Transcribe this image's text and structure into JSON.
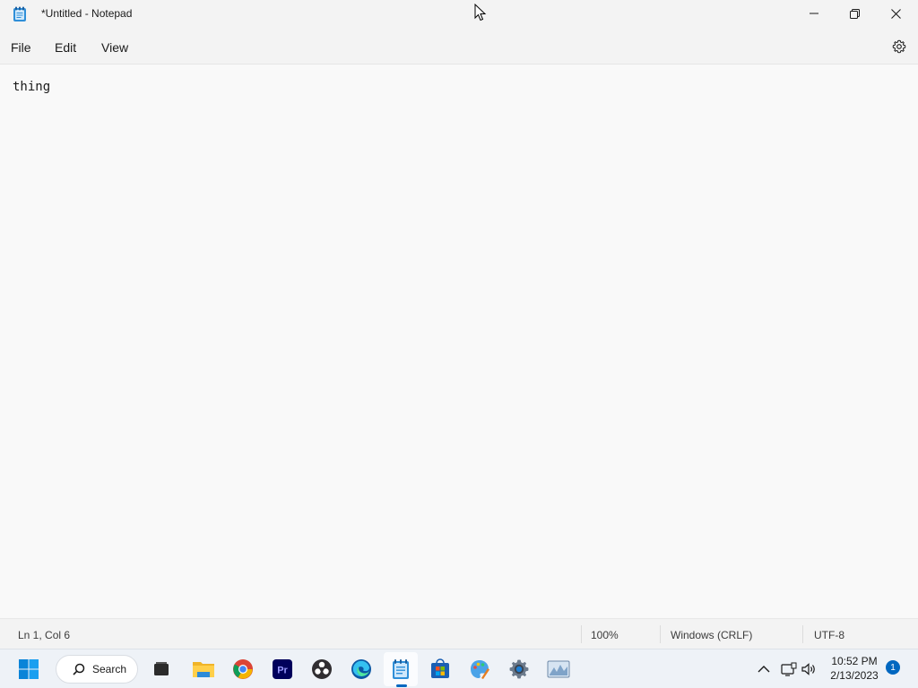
{
  "window": {
    "title": "*Untitled - Notepad",
    "app": "Notepad"
  },
  "menu": {
    "file": "File",
    "edit": "Edit",
    "view": "View"
  },
  "editor": {
    "content": "thing"
  },
  "status": {
    "position": "Ln 1, Col 6",
    "zoom": "100%",
    "line_ending": "Windows (CRLF)",
    "encoding": "UTF-8"
  },
  "taskbar": {
    "search_label": "Search",
    "apps": [
      {
        "name": "start",
        "icon": "windows-logo-icon"
      },
      {
        "name": "task-view",
        "icon": "task-view-icon"
      },
      {
        "name": "file-explorer",
        "icon": "folder-icon"
      },
      {
        "name": "chrome",
        "icon": "chrome-icon"
      },
      {
        "name": "premiere-pro",
        "icon": "premiere-pro-icon"
      },
      {
        "name": "obs",
        "icon": "obs-icon"
      },
      {
        "name": "edge",
        "icon": "edge-icon"
      },
      {
        "name": "notepad",
        "icon": "notepad-icon",
        "active": true
      },
      {
        "name": "microsoft-store",
        "icon": "store-icon"
      },
      {
        "name": "paint",
        "icon": "paint-icon"
      },
      {
        "name": "settings",
        "icon": "settings-gear-icon"
      },
      {
        "name": "photo-viewer",
        "icon": "image-icon"
      }
    ],
    "time": "10:52 PM",
    "date": "2/13/2023",
    "notification_count": "1"
  },
  "colors": {
    "accent": "#0067c0",
    "background": "#f9f9f9",
    "chrome": "#f3f3f3"
  }
}
